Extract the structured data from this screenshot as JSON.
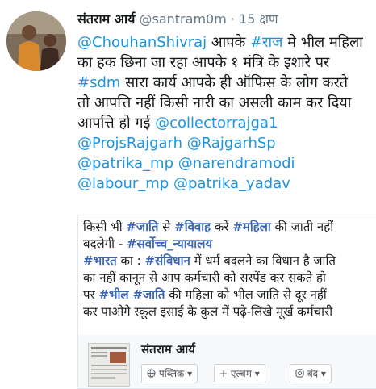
{
  "header": {
    "name": "संतराम आर्य",
    "handle": "@santram0m",
    "separator": "·",
    "time": "15 क्षण"
  },
  "tweet": {
    "l1_link": "@ChouhanShivraj",
    "l1_mid": " आपके ",
    "l1_tag": "#राज",
    "l1_rest": " मे भील महिला",
    "l2": "का हक छिना जा रहा आपके १ मंत्रि के इशारे पर",
    "l3_tag": "#sdm",
    "l3_rest": " सारा कार्य आपके ही ऑफिस के लोग करते",
    "l4": "तो आपत्ति नहीं किसी नारी का असली काम कर दिया",
    "l5_text": "आपत्ति हो गई ",
    "l5_link": "@collectorrajga1",
    "l6a": "@ProjsRajgarh",
    "l6b": "@RajgarhSp",
    "l7a": "@patrika_mp",
    "l7b": "@narendramodi",
    "l8a": "@labour_mp",
    "l8b": "@patrika_yadav"
  },
  "card": {
    "c1a": "किसी भी ",
    "c1b": "#जाति",
    "c1c": " से ",
    "c1d": "#विवाह",
    "c1e": " करें ",
    "c1f": "#महिला",
    "c1g": " की जाती नहीं",
    "c2a": "बदलेगी - ",
    "c2b": "#सर्वोच्च_न्यायालय",
    "c3a": "#भारत",
    "c3b": " का : ",
    "c3c": "#संविधान",
    "c3d": " में धर्म बदलने का विधान है जाति",
    "c4": "का नहीं कानून से आप कर्मचारी को सस्पेंड कर सकते हो",
    "c5a": "पर ",
    "c5b": "#भील",
    "c5c": " ",
    "c5d": "#जाति",
    "c5e": " की महिला को भील जाति से दूर नहीं",
    "c6": "कर पाओगे स्कूल इसाई के कुल में पढ़े-लिखे मूर्ख कर्मचारी"
  },
  "fb": {
    "name": "संतराम आर्य",
    "privacy": "पब्लिक",
    "album": "+ एल्बम",
    "closed": "बंद"
  },
  "icons": [
    "globe-icon",
    "chevron-down-icon",
    "instagram-icon"
  ]
}
